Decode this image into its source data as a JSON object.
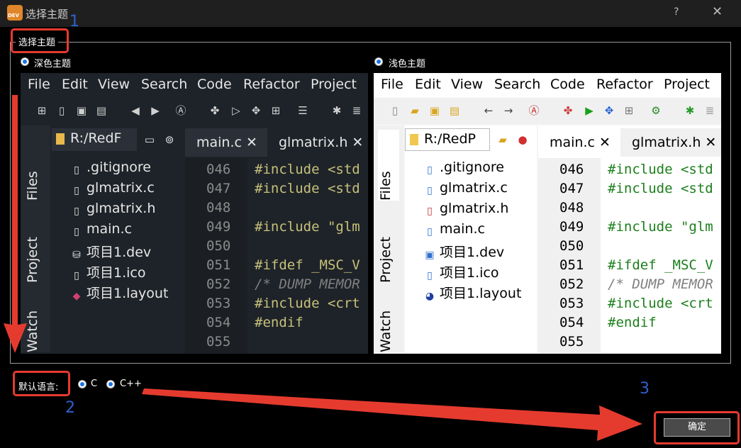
{
  "window": {
    "title": "选择主题",
    "help": "?",
    "close": "✕"
  },
  "group": {
    "legend": "选择主题"
  },
  "themes": [
    {
      "label": "深色主题",
      "selected": true
    },
    {
      "label": "浅色主题",
      "selected": false
    }
  ],
  "preview": {
    "menu": [
      "File",
      "Edit",
      "View",
      "Search",
      "Code",
      "Refactor",
      "Project"
    ],
    "side_tabs": [
      "Files",
      "Project",
      "Watch"
    ],
    "path": "R:/RedF",
    "path_light": "R:/RedP",
    "files": [
      ".gitignore",
      "glmatrix.c",
      "glmatrix.h",
      "main.c",
      "项目1.dev",
      "项目1.ico",
      "项目1.layout"
    ],
    "editor_tabs": [
      "main.c",
      "glmatrix.h"
    ],
    "line_numbers": [
      "046",
      "047",
      "048",
      "049",
      "050",
      "051",
      "052",
      "053",
      "054",
      "055"
    ],
    "code": [
      "#include <std",
      "#include <std",
      "",
      "#include \"glm",
      "",
      "#ifdef _MSC_V",
      "/* DUMP MEMOR",
      "#include <crt",
      "#endif",
      ""
    ]
  },
  "language": {
    "label": "默认语言:",
    "options": [
      {
        "label": "C",
        "selected": false
      },
      {
        "label": "C++",
        "selected": true
      }
    ]
  },
  "ok_button": "确定",
  "annotations": [
    "1",
    "2",
    "3"
  ],
  "colors": {
    "annotation_red": "#e53b2f",
    "annotation_blue": "#2f5fd0",
    "radio_accent": "#1a73e8"
  }
}
